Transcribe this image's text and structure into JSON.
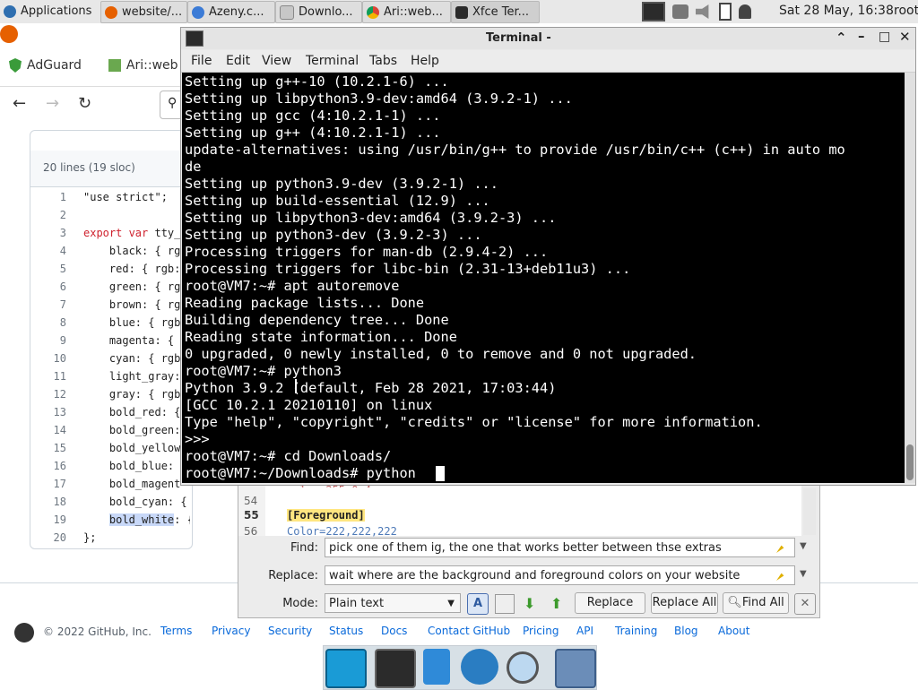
{
  "panel": {
    "tabs": [
      {
        "label": "Applications",
        "icon": "xfce-mouse-icon"
      },
      {
        "label": "website/...",
        "icon": "firefox-icon"
      },
      {
        "label": "Azeny.c...",
        "icon": "azeny-icon"
      },
      {
        "label": "Downlo...",
        "icon": "folder-icon"
      },
      {
        "label": "Ari::web...",
        "icon": "chrome-icon"
      },
      {
        "label": "Xfce Ter...",
        "icon": "terminal-icon"
      }
    ],
    "clock": "Sat 28 May, 16:38",
    "user": "root"
  },
  "browser": {
    "bookmarks": [
      "AdGuard",
      "Ari::web"
    ],
    "code_header": "20 lines (19 sloc)",
    "code_lines": [
      {
        "n": "1",
        "text": "\"use strict\";"
      },
      {
        "n": "2",
        "text": ""
      },
      {
        "n": "3",
        "kw": "export var",
        "text": " tty_"
      },
      {
        "n": "4",
        "text": "    black: { rg"
      },
      {
        "n": "5",
        "text": "    red: { rgb:"
      },
      {
        "n": "6",
        "text": "    green: { rg"
      },
      {
        "n": "7",
        "text": "    brown: { rg"
      },
      {
        "n": "8",
        "text": "    blue: { rgb"
      },
      {
        "n": "9",
        "text": "    magenta: {"
      },
      {
        "n": "10",
        "text": "    cyan: { rgb"
      },
      {
        "n": "11",
        "text": "    light_gray:"
      },
      {
        "n": "12",
        "text": "    gray: { rgb"
      },
      {
        "n": "13",
        "text": "    bold_red: {"
      },
      {
        "n": "14",
        "text": "    bold_green:"
      },
      {
        "n": "15",
        "text": "    bold_yellow"
      },
      {
        "n": "16",
        "text": "    bold_blue:"
      },
      {
        "n": "17",
        "text": "    bold_magent"
      },
      {
        "n": "18",
        "text": "    bold_cyan: { rgb: [8"
      },
      {
        "n": "19",
        "sel": "bold_white",
        "text": ": { rgb: ["
      },
      {
        "n": "20",
        "text": "};"
      }
    ],
    "footer": {
      "copyright": "© 2022 GitHub, Inc.",
      "links": [
        "Terms",
        "Privacy",
        "Security",
        "Status",
        "Docs",
        "Contact GitHub",
        "Pricing",
        "API",
        "Training",
        "Blog",
        "About"
      ]
    }
  },
  "editor": {
    "gutter": [
      "54",
      "55",
      "56"
    ],
    "line_53_partial": "color=255,0,4",
    "line_55": "[Foreground]",
    "line_56": "Color=222,222,222",
    "find_label": "Find:",
    "find_value": "pick one of them ig, the one that works better between thse extras",
    "replace_label": "Replace:",
    "replace_value": "wait where are the background and foreground colors on your website",
    "mode_label": "Mode:",
    "mode_value": "Plain text",
    "replace_button": "Replace",
    "replace_all_button": "Replace All",
    "find_all_button": "Find All"
  },
  "terminal": {
    "title": "Terminal -",
    "menu": [
      "File",
      "Edit",
      "View",
      "Terminal",
      "Tabs",
      "Help"
    ],
    "lines": [
      "Setting up g++-10 (10.2.1-6) ...",
      "Setting up libpython3.9-dev:amd64 (3.9.2-1) ...",
      "Setting up gcc (4:10.2.1-1) ...",
      "Setting up g++ (4:10.2.1-1) ...",
      "update-alternatives: using /usr/bin/g++ to provide /usr/bin/c++ (c++) in auto mo",
      "de",
      "Setting up python3.9-dev (3.9.2-1) ...",
      "Setting up build-essential (12.9) ...",
      "Setting up libpython3-dev:amd64 (3.9.2-3) ...",
      "Setting up python3-dev (3.9.2-3) ...",
      "Processing triggers for man-db (2.9.4-2) ...",
      "Processing triggers for libc-bin (2.31-13+deb11u3) ...",
      "root@VM7:~# apt autoremove",
      "Reading package lists... Done",
      "Building dependency tree... Done",
      "Reading state information... Done",
      "0 upgraded, 0 newly installed, 0 to remove and 0 not upgraded.",
      "root@VM7:~# python3",
      "Python 3.9.2 (default, Feb 28 2021, 17:03:44)",
      "[GCC 10.2.1 20210110] on linux",
      "Type \"help\", \"copyright\", \"credits\" or \"license\" for more information.",
      ">>>",
      "root@VM7:~# cd Downloads/",
      "root@VM7:~/Downloads# python"
    ]
  },
  "colors": {
    "terminal_bg": "#000000",
    "terminal_fg": "#ffffff",
    "link": "#0969da"
  }
}
